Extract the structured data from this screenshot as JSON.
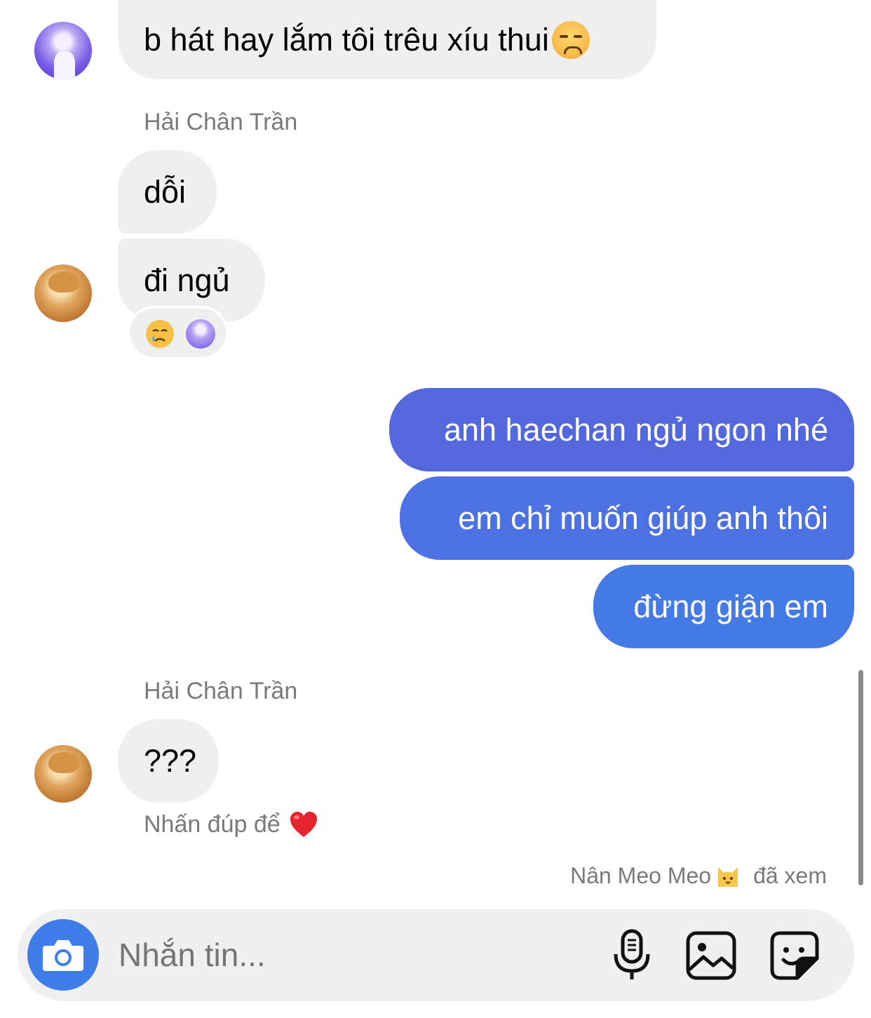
{
  "messages": {
    "m1": {
      "text": "b hát hay lắm tôi trêu xíu thui",
      "emoji": "disappointed-face-emoji"
    },
    "sender_a": "Hải Chân Trần",
    "m2": {
      "text": "dỗi"
    },
    "m3": {
      "text": "đi ngủ",
      "reactions": [
        "crying-face-emoji",
        "reactor-avatar"
      ]
    },
    "m4": {
      "text": "anh haechan ngủ ngon nhé"
    },
    "m5": {
      "text": "em chỉ muốn giúp anh thôi"
    },
    "m6": {
      "text": "đừng giận em"
    },
    "sender_b": "Hải Chân Trần",
    "m7": {
      "text": "???"
    },
    "hint": {
      "text": "Nhấn đúp để",
      "icon": "heart-icon"
    },
    "seen": {
      "name": "Nân Meo Meo",
      "emoji": "cat-emoji",
      "suffix": "đã xem"
    }
  },
  "composer": {
    "placeholder": "Nhắn tin...",
    "icons": [
      "camera-icon",
      "microphone-icon",
      "image-icon",
      "sticker-icon"
    ]
  },
  "colors": {
    "incoming_bubble": "#efefef",
    "outgoing_top": "#5b5fdd",
    "outgoing_bottom": "#3f7be6",
    "camera_button": "#3f7ee8",
    "meta_text": "#7a7a7a"
  }
}
